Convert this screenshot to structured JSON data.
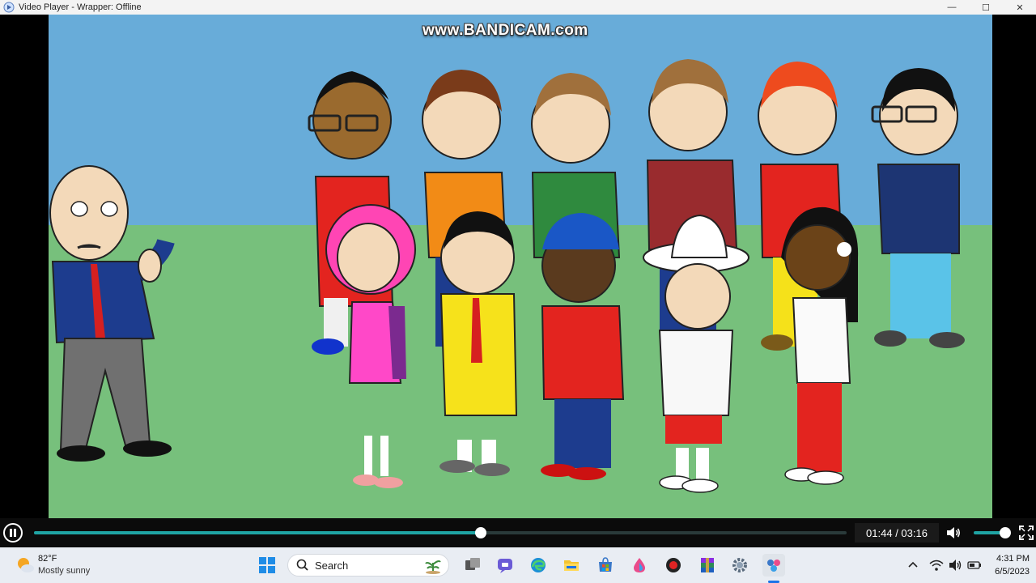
{
  "window": {
    "title": "Video Player - Wrapper: Offline",
    "controls": {
      "minimize": "—",
      "maximize": "☐",
      "close": "✕"
    }
  },
  "watermark": "www.BANDICAM.com",
  "player": {
    "time_display": "01:44 / 03:16",
    "progress": 0.5495,
    "volume": 0.85,
    "accent_color": "#1fa3a3"
  },
  "taskbar": {
    "weather": {
      "temp": "82°F",
      "condition": "Mostly sunny"
    },
    "search_label": "Search",
    "pinned_apps": [
      "windows-start",
      "search",
      "task-view",
      "teams-chat",
      "edge",
      "file-explorer",
      "microsoft-store",
      "paint-drop",
      "bandicam-record",
      "winrar",
      "settings",
      "wrapper-offline"
    ],
    "tray": {
      "time": "4:31 PM",
      "date": "6/5/2023"
    }
  }
}
